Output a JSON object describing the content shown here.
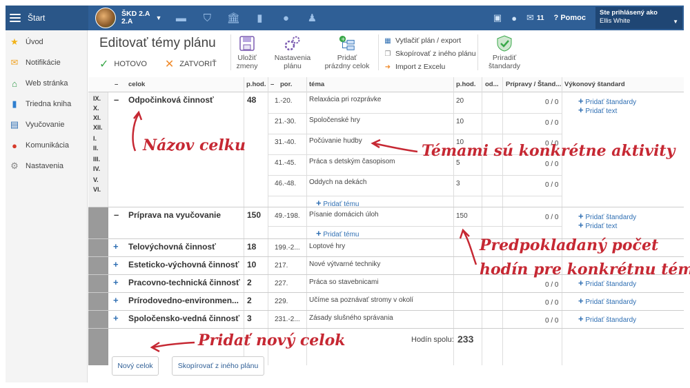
{
  "topbar": {
    "start_label": "Štart",
    "school_line1": "ŠKD 2.A",
    "school_line2": "2.A",
    "messages_count": "11",
    "help_label": "Pomoc",
    "user_status": "Ste prihlásený ako",
    "user_name": "Ellis White"
  },
  "sidebar": {
    "items": [
      {
        "label": "Úvod",
        "icon": "star-icon",
        "color": "#f2b31a"
      },
      {
        "label": "Notifikácie",
        "icon": "envelope-icon",
        "color": "#f0a52a"
      },
      {
        "label": "Web stránka",
        "icon": "home-icon",
        "color": "#2e9a47"
      },
      {
        "label": "Triedna kniha",
        "icon": "book-icon",
        "color": "#2f7fcf"
      },
      {
        "label": "Vyučovanie",
        "icon": "open-book-icon",
        "color": "#2f6fb3"
      },
      {
        "label": "Komunikácia",
        "icon": "chat-icon",
        "color": "#d63a2a"
      },
      {
        "label": "Nastavenia",
        "icon": "gear-icon",
        "color": "#888888"
      }
    ]
  },
  "page": {
    "title": "Editovať témy plánu",
    "done_label": "HOTOVO",
    "close_label": "ZATVORIŤ",
    "save_label_1": "Uložiť",
    "save_label_2": "zmeny",
    "plan_settings_1": "Nastavenia",
    "plan_settings_2": "plánu",
    "add_empty_1": "Pridať",
    "add_empty_2": "prázdny celok",
    "print_label": "Vytlačiť plán / export",
    "copy_label": "Skopírovať z iného plánu",
    "import_label": "Import z Excelu",
    "assign_std_1": "Priradiť",
    "assign_std_2": "štandardy"
  },
  "table": {
    "headers": {
      "collapse": "–",
      "celok": "celok",
      "phod": "p.hod.",
      "por_collapse": "–",
      "por": "por.",
      "tema": "téma",
      "phod2": "p.hod.",
      "od": "od...",
      "pripravy": "Prípravy / Štand...",
      "vykonovy": "Výkonový štandard"
    },
    "months": [
      "IX.",
      "X.",
      "XI.",
      "XII.",
      "I.",
      "II.",
      "III.",
      "IV.",
      "V.",
      "VI."
    ],
    "add_topic": "Pridať tému",
    "add_standard": "Pridať štandardy",
    "add_text": "Pridať text",
    "units": [
      {
        "sign": "–",
        "name": "Odpočinková činnosť",
        "hours": "48",
        "topics": [
          {
            "por": "1.-20.",
            "tema": "Relaxácia pri rozprávke",
            "hours": "20",
            "prep": "0 / 0"
          },
          {
            "por": "21.-30.",
            "tema": "Spoločenské hry",
            "hours": "10",
            "prep": "0 / 0"
          },
          {
            "por": "31.-40.",
            "tema": "Počúvanie hudby",
            "hours": "10",
            "prep": "0 / 0"
          },
          {
            "por": "41.-45.",
            "tema": "Práca s detským časopisom",
            "hours": "5",
            "prep": "0 / 0"
          },
          {
            "por": "46.-48.",
            "tema": "Oddych na dekách",
            "hours": "3",
            "prep": "0 / 0"
          }
        ]
      },
      {
        "sign": "–",
        "name": "Príprava na vyučovanie",
        "hours": "150",
        "topics": [
          {
            "por": "49.-198.",
            "tema": "Písanie domácich úloh",
            "hours": "150",
            "prep": "0 / 0"
          }
        ]
      },
      {
        "sign": "+",
        "name": "Telovýchovná činnosť",
        "hours": "18",
        "por": "199.-2...",
        "tema": "Loptové hry",
        "prep": ""
      },
      {
        "sign": "+",
        "name": "Esteticko-výchovná činnosť",
        "hours": "10",
        "por": "217.",
        "tema": "Nové výtvarné techniky",
        "prep": ""
      },
      {
        "sign": "+",
        "name": "Pracovno-technická činnosť",
        "hours": "2",
        "por": "227.",
        "tema": "Práca so stavebnicami",
        "prep": "0 / 0"
      },
      {
        "sign": "+",
        "name": "Prírodovedno-environmen...",
        "hours": "2",
        "por": "229.",
        "tema": "Učíme sa poznávať stromy v okolí",
        "prep": "0 / 0"
      },
      {
        "sign": "+",
        "name": "Spoločensko-vedná činnosť",
        "hours": "3",
        "por": "231.-2...",
        "tema": "Zásady slušného správania",
        "prep": "0 / 0"
      }
    ],
    "total_label": "Hodín spolu:",
    "total_value": "233"
  },
  "buttons": {
    "new_unit": "Nový celok",
    "copy_plan": "Skopírovať z iného plánu"
  },
  "annotations": {
    "unit_name": "Názov celku",
    "topics_are": "Témami sú konkrétne aktivity",
    "expected_1": "Predpokladaný počet",
    "expected_2": "hodín pre konkrétnu tému",
    "add_unit": "Pridať nový celok"
  }
}
